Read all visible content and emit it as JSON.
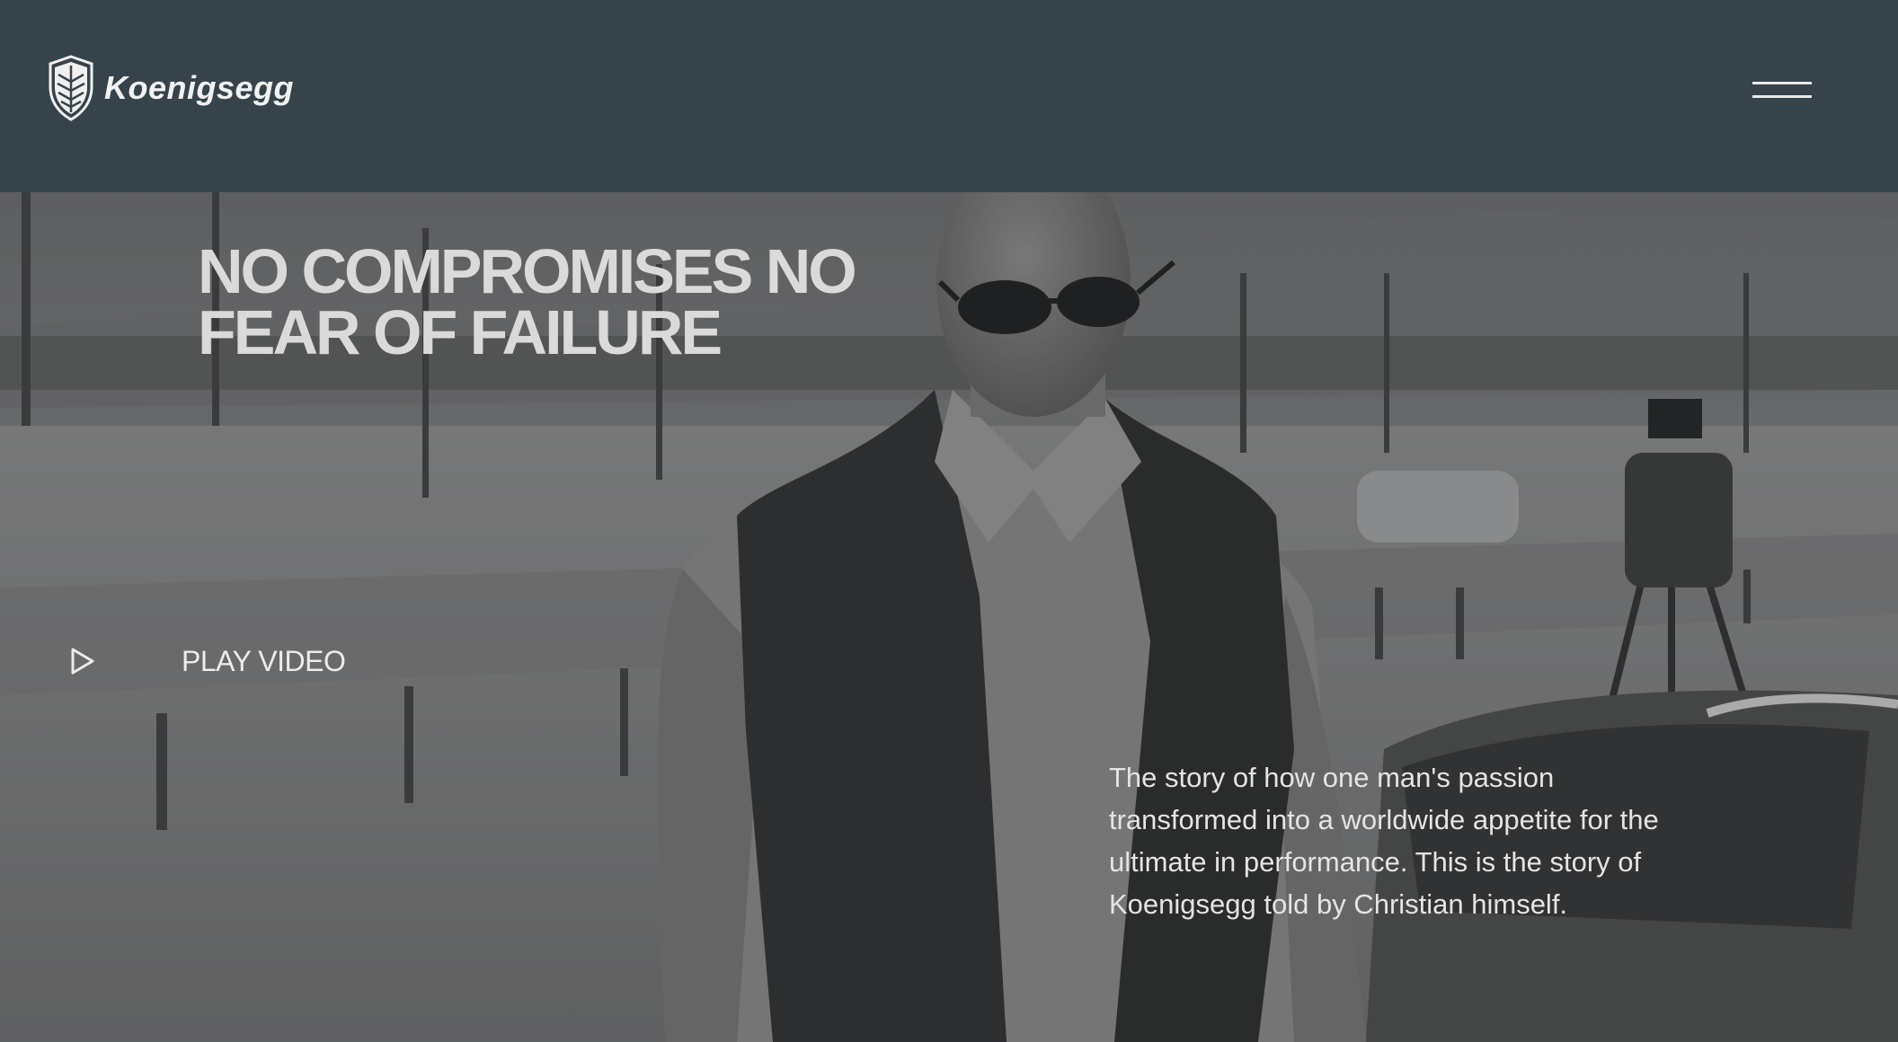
{
  "header": {
    "logo_text": "Koenigsegg",
    "logo_icon": "koenigsegg-shield-icon",
    "menu_icon": "hamburger-menu-icon",
    "background_color": "#37434b"
  },
  "hero": {
    "headline": "NO COMPROMISES NO FEAR OF FAILURE",
    "play_video_label": "PLAY VIDEO",
    "play_icon": "play-icon",
    "story_text": "The story of how one man's passion transformed into a worldwide appetite for the ultimate in performance. This is the story of Koenigsegg told by Christian himself."
  }
}
